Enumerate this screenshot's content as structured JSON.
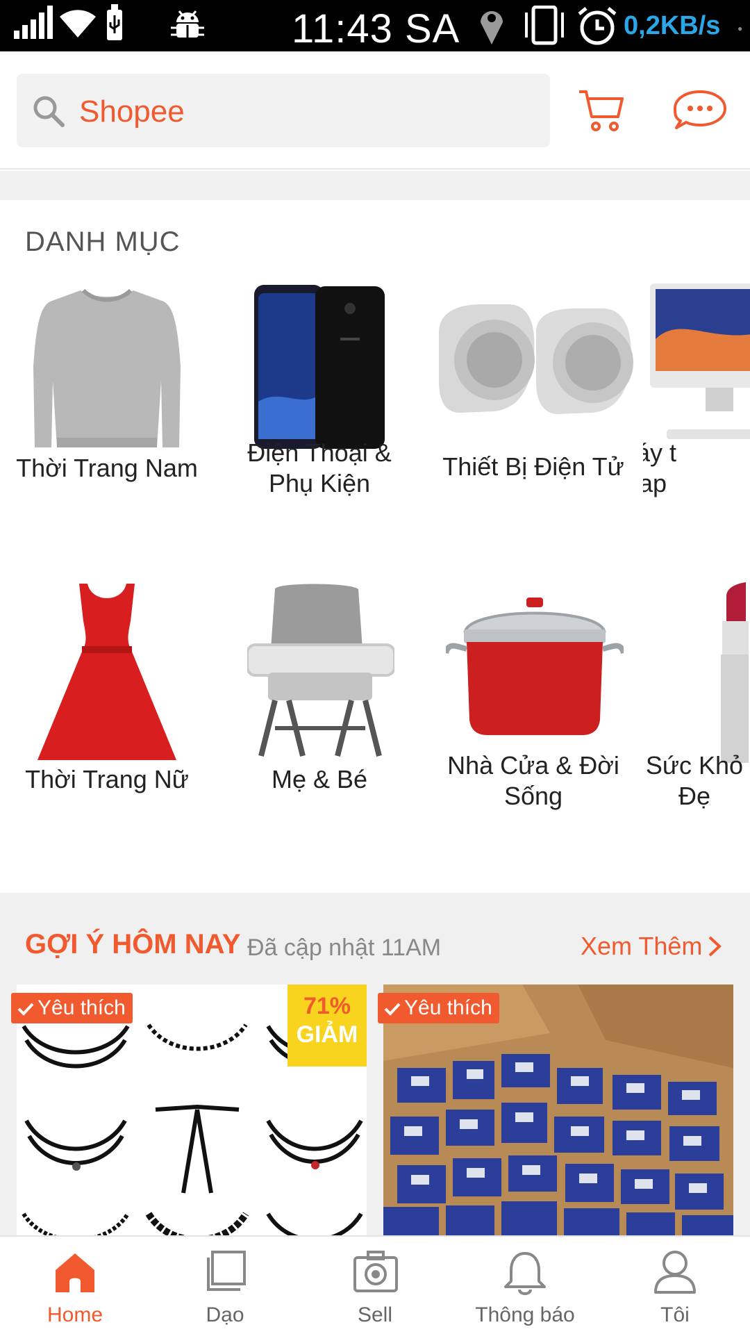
{
  "status_bar": {
    "time": "11:43 SA",
    "net_speed": "0,2KB/s",
    "icons": [
      "signal-icon",
      "wifi-icon",
      "usb-icon",
      "android-debug-icon",
      "location-icon",
      "vibrate-icon",
      "alarm-icon"
    ]
  },
  "header": {
    "search_placeholder": "Shopee",
    "icons": [
      "search-icon",
      "cart-icon",
      "chat-icon"
    ]
  },
  "categories": {
    "title": "DANH MỤC",
    "items": [
      {
        "label": "Thời Trang Nam",
        "icon": "sweater-icon"
      },
      {
        "label": "Điện Thoại &\nPhụ Kiện",
        "icon": "phone-icon"
      },
      {
        "label": "Thiết Bị Điện Tử",
        "icon": "speakers-icon"
      },
      {
        "label": "Máy t\nLap",
        "icon": "computer-icon"
      },
      {
        "label": "Thời Trang Nữ",
        "icon": "dress-icon"
      },
      {
        "label": "Mẹ & Bé",
        "icon": "baby-seat-icon"
      },
      {
        "label": "Nhà Cửa & Đời\nSống",
        "icon": "pot-icon"
      },
      {
        "label": "Sức Khỏ\nĐẹ",
        "icon": "lipstick-icon"
      }
    ]
  },
  "suggestions": {
    "title": "GỢI Ý HÔM NAY",
    "updated": "Đã cập nhật 11AM",
    "more_label": "Xem Thêm",
    "products": [
      {
        "badge": "Yêu thích",
        "discount_percent": "71%",
        "discount_label": "GIẢM",
        "image": "choker-necklaces-image"
      },
      {
        "badge": "Yêu thích",
        "image": "boxes-image"
      }
    ]
  },
  "bottom_nav": {
    "items": [
      {
        "label": "Home",
        "icon": "home-icon",
        "active": true
      },
      {
        "label": "Dạo",
        "icon": "feed-icon",
        "active": false
      },
      {
        "label": "Sell",
        "icon": "camera-icon",
        "active": false
      },
      {
        "label": "Thông báo",
        "icon": "bell-icon",
        "active": false
      },
      {
        "label": "Tôi",
        "icon": "profile-icon",
        "active": false
      }
    ]
  },
  "colors": {
    "accent": "#f05a2e",
    "discount_bg": "#f8d41e",
    "speed": "#2aa7e8",
    "section_bg": "#f0f0f0"
  }
}
